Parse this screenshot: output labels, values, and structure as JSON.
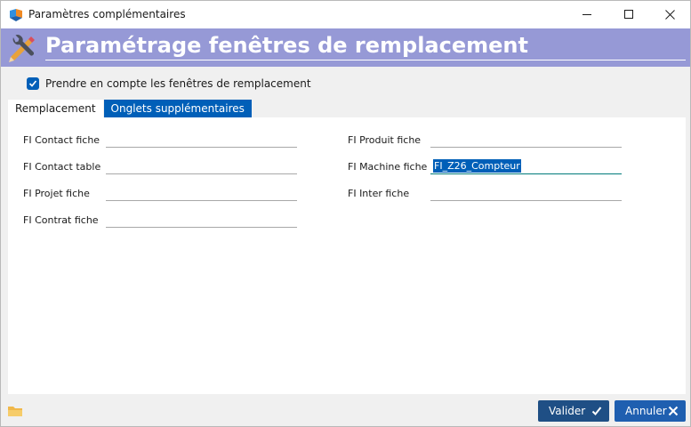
{
  "window": {
    "title": "Paramètres complémentaires",
    "controls": {
      "minimize": "minimize",
      "maximize": "maximize",
      "close": "close"
    }
  },
  "banner": {
    "title": "Paramétrage fenêtres de remplacement"
  },
  "options": {
    "use_replacement_windows": {
      "label": "Prendre en compte les fenêtres de remplacement",
      "checked": true
    }
  },
  "tabs": [
    {
      "label": "Remplacement",
      "active": true
    },
    {
      "label": "Onglets supplémentaires",
      "active": false
    }
  ],
  "fields": {
    "left": [
      {
        "label": "FI Contact fiche",
        "value": ""
      },
      {
        "label": "FI Contact table",
        "value": ""
      },
      {
        "label": "FI Projet fiche",
        "value": ""
      },
      {
        "label": "FI Contrat fiche",
        "value": ""
      }
    ],
    "right": [
      {
        "label": "FI Produit fiche",
        "value": ""
      },
      {
        "label": "FI Machine fiche",
        "value": "FI_Z26_Compteur"
      },
      {
        "label": "FI Inter fiche",
        "value": ""
      }
    ]
  },
  "footer": {
    "valider_label": "Valider",
    "annuler_label": "Annuler"
  },
  "colors": {
    "banner": "#9699d6",
    "accent": "#005fb8",
    "button": "#1f4f85"
  }
}
